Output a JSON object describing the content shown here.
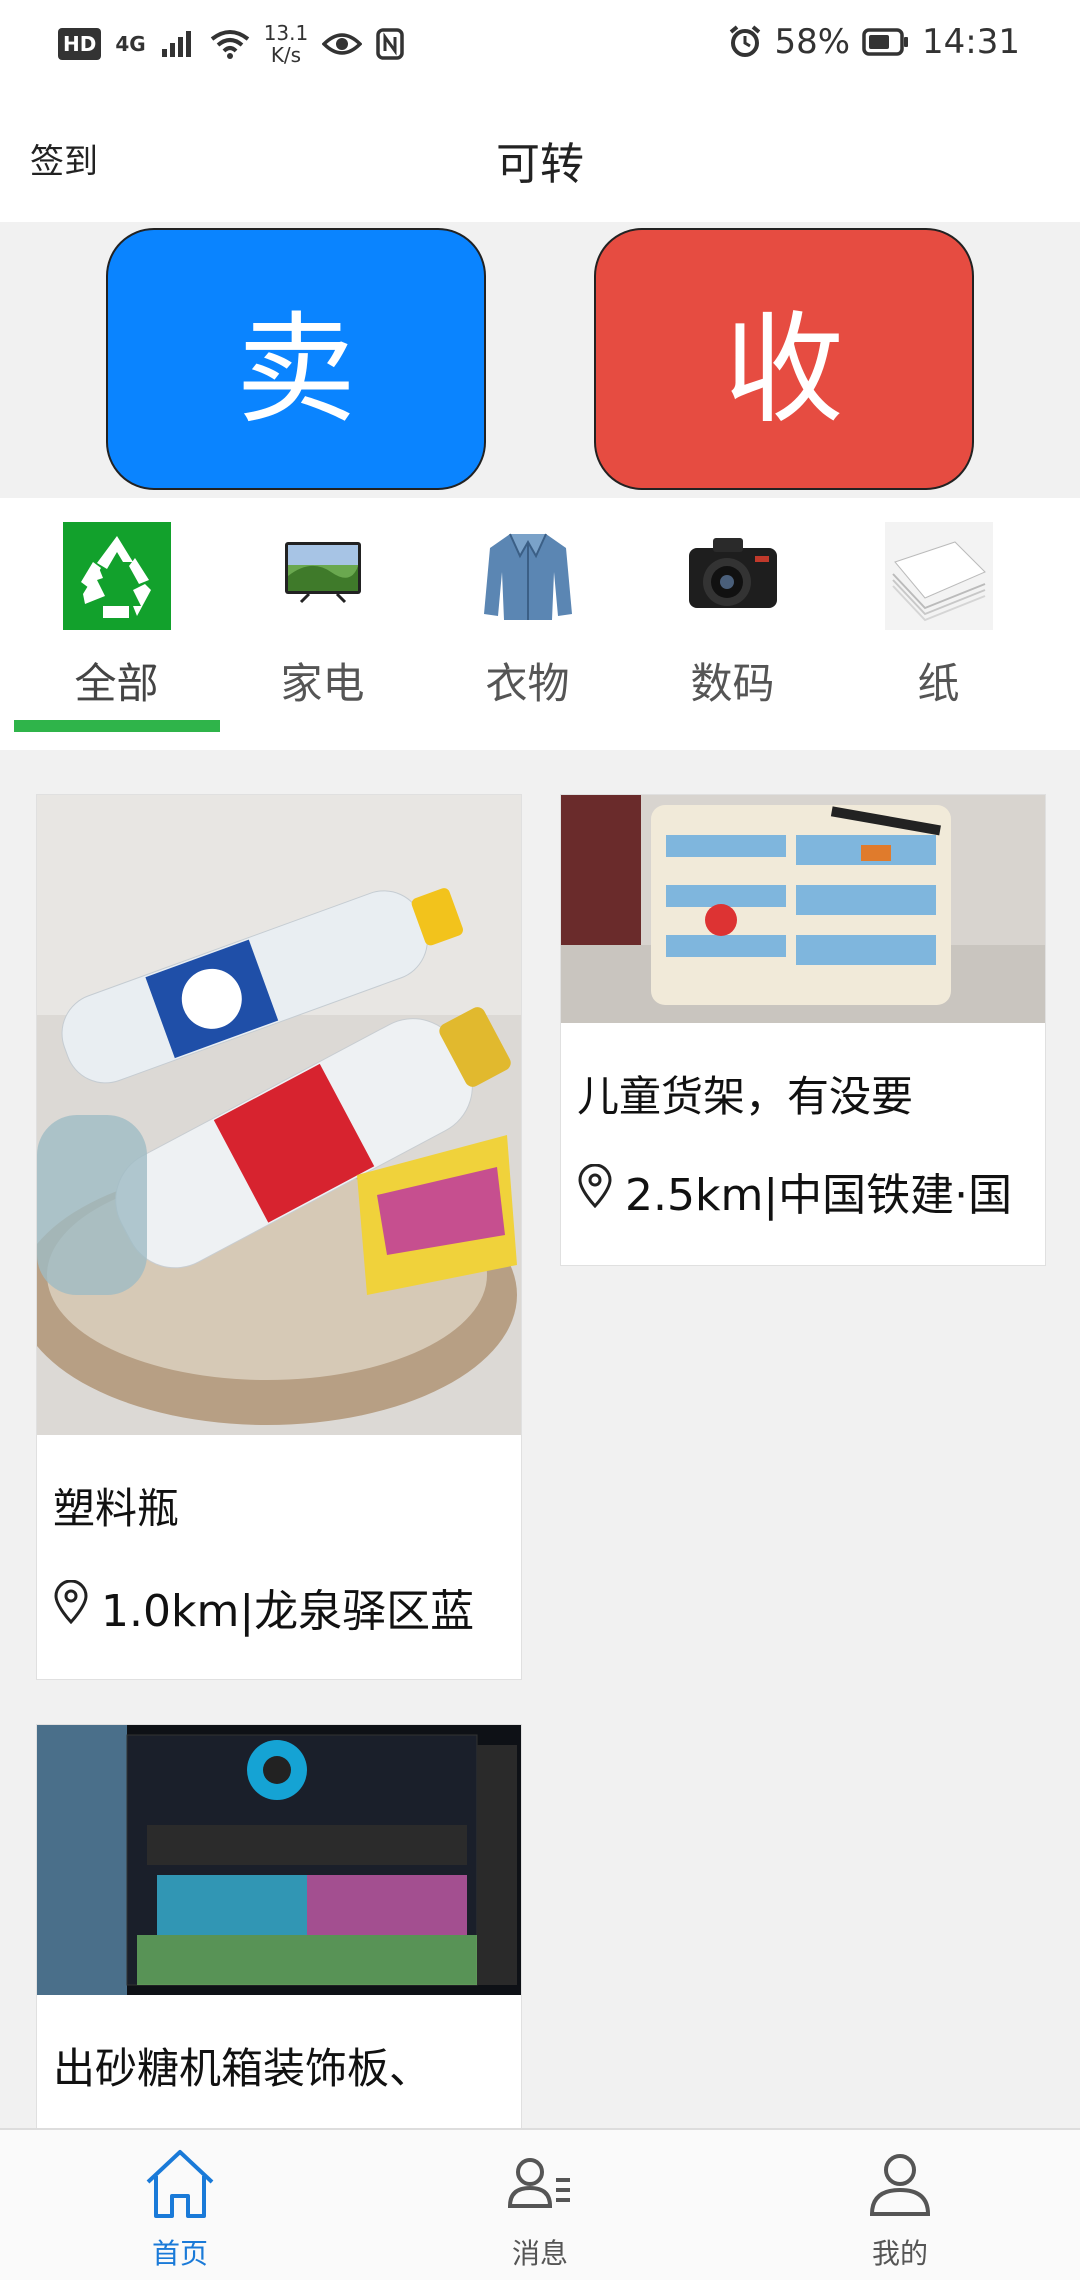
{
  "status_bar": {
    "hd": "HD",
    "network": "4G",
    "speed_value": "13.1",
    "speed_unit": "K/s",
    "battery": "58%",
    "time": "14:31"
  },
  "header": {
    "signin_label": "签到",
    "title": "可转"
  },
  "actions": {
    "sell_label": "卖",
    "buy_label": "收",
    "sell_color": "#0a84ff",
    "buy_color": "#e64c41"
  },
  "categories": [
    {
      "label": "全部",
      "icon": "recycle-icon",
      "active": true
    },
    {
      "label": "家电",
      "icon": "tv-icon",
      "active": false
    },
    {
      "label": "衣物",
      "icon": "jacket-icon",
      "active": false
    },
    {
      "label": "数码",
      "icon": "camera-icon",
      "active": false
    },
    {
      "label": "纸",
      "icon": "paper-stack-icon",
      "active": false
    }
  ],
  "accent_color": "#2fb44a",
  "listings": [
    {
      "title": "塑料瓶",
      "location": "1.0km|龙泉驿区蓝",
      "image": "plastic-bottles-photo"
    },
    {
      "title": "儿童货架，有没要",
      "location": "2.5km|中国铁建·国",
      "image": "kids-shelf-photo"
    },
    {
      "title": "出砂糖机箱装饰板、",
      "location": "",
      "image": "pc-case-photo"
    }
  ],
  "bottom_nav": [
    {
      "label": "首页",
      "icon": "home-icon",
      "active": true
    },
    {
      "label": "消息",
      "icon": "message-contacts-icon",
      "active": false
    },
    {
      "label": "我的",
      "icon": "profile-icon",
      "active": false
    }
  ]
}
